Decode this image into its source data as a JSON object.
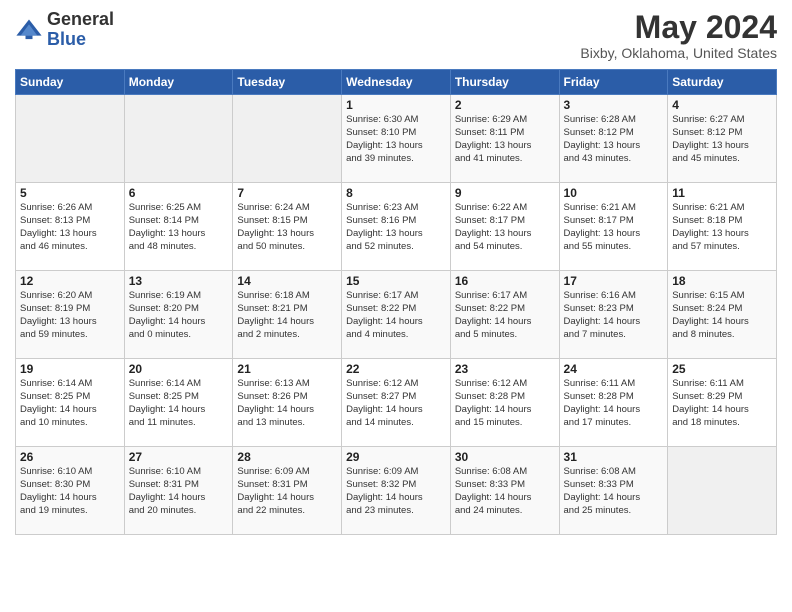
{
  "logo": {
    "general": "General",
    "blue": "Blue"
  },
  "title": "May 2024",
  "subtitle": "Bixby, Oklahoma, United States",
  "days_of_week": [
    "Sunday",
    "Monday",
    "Tuesday",
    "Wednesday",
    "Thursday",
    "Friday",
    "Saturday"
  ],
  "weeks": [
    [
      {
        "day": "",
        "info": ""
      },
      {
        "day": "",
        "info": ""
      },
      {
        "day": "",
        "info": ""
      },
      {
        "day": "1",
        "info": "Sunrise: 6:30 AM\nSunset: 8:10 PM\nDaylight: 13 hours\nand 39 minutes."
      },
      {
        "day": "2",
        "info": "Sunrise: 6:29 AM\nSunset: 8:11 PM\nDaylight: 13 hours\nand 41 minutes."
      },
      {
        "day": "3",
        "info": "Sunrise: 6:28 AM\nSunset: 8:12 PM\nDaylight: 13 hours\nand 43 minutes."
      },
      {
        "day": "4",
        "info": "Sunrise: 6:27 AM\nSunset: 8:12 PM\nDaylight: 13 hours\nand 45 minutes."
      }
    ],
    [
      {
        "day": "5",
        "info": "Sunrise: 6:26 AM\nSunset: 8:13 PM\nDaylight: 13 hours\nand 46 minutes."
      },
      {
        "day": "6",
        "info": "Sunrise: 6:25 AM\nSunset: 8:14 PM\nDaylight: 13 hours\nand 48 minutes."
      },
      {
        "day": "7",
        "info": "Sunrise: 6:24 AM\nSunset: 8:15 PM\nDaylight: 13 hours\nand 50 minutes."
      },
      {
        "day": "8",
        "info": "Sunrise: 6:23 AM\nSunset: 8:16 PM\nDaylight: 13 hours\nand 52 minutes."
      },
      {
        "day": "9",
        "info": "Sunrise: 6:22 AM\nSunset: 8:17 PM\nDaylight: 13 hours\nand 54 minutes."
      },
      {
        "day": "10",
        "info": "Sunrise: 6:21 AM\nSunset: 8:17 PM\nDaylight: 13 hours\nand 55 minutes."
      },
      {
        "day": "11",
        "info": "Sunrise: 6:21 AM\nSunset: 8:18 PM\nDaylight: 13 hours\nand 57 minutes."
      }
    ],
    [
      {
        "day": "12",
        "info": "Sunrise: 6:20 AM\nSunset: 8:19 PM\nDaylight: 13 hours\nand 59 minutes."
      },
      {
        "day": "13",
        "info": "Sunrise: 6:19 AM\nSunset: 8:20 PM\nDaylight: 14 hours\nand 0 minutes."
      },
      {
        "day": "14",
        "info": "Sunrise: 6:18 AM\nSunset: 8:21 PM\nDaylight: 14 hours\nand 2 minutes."
      },
      {
        "day": "15",
        "info": "Sunrise: 6:17 AM\nSunset: 8:22 PM\nDaylight: 14 hours\nand 4 minutes."
      },
      {
        "day": "16",
        "info": "Sunrise: 6:17 AM\nSunset: 8:22 PM\nDaylight: 14 hours\nand 5 minutes."
      },
      {
        "day": "17",
        "info": "Sunrise: 6:16 AM\nSunset: 8:23 PM\nDaylight: 14 hours\nand 7 minutes."
      },
      {
        "day": "18",
        "info": "Sunrise: 6:15 AM\nSunset: 8:24 PM\nDaylight: 14 hours\nand 8 minutes."
      }
    ],
    [
      {
        "day": "19",
        "info": "Sunrise: 6:14 AM\nSunset: 8:25 PM\nDaylight: 14 hours\nand 10 minutes."
      },
      {
        "day": "20",
        "info": "Sunrise: 6:14 AM\nSunset: 8:25 PM\nDaylight: 14 hours\nand 11 minutes."
      },
      {
        "day": "21",
        "info": "Sunrise: 6:13 AM\nSunset: 8:26 PM\nDaylight: 14 hours\nand 13 minutes."
      },
      {
        "day": "22",
        "info": "Sunrise: 6:12 AM\nSunset: 8:27 PM\nDaylight: 14 hours\nand 14 minutes."
      },
      {
        "day": "23",
        "info": "Sunrise: 6:12 AM\nSunset: 8:28 PM\nDaylight: 14 hours\nand 15 minutes."
      },
      {
        "day": "24",
        "info": "Sunrise: 6:11 AM\nSunset: 8:28 PM\nDaylight: 14 hours\nand 17 minutes."
      },
      {
        "day": "25",
        "info": "Sunrise: 6:11 AM\nSunset: 8:29 PM\nDaylight: 14 hours\nand 18 minutes."
      }
    ],
    [
      {
        "day": "26",
        "info": "Sunrise: 6:10 AM\nSunset: 8:30 PM\nDaylight: 14 hours\nand 19 minutes."
      },
      {
        "day": "27",
        "info": "Sunrise: 6:10 AM\nSunset: 8:31 PM\nDaylight: 14 hours\nand 20 minutes."
      },
      {
        "day": "28",
        "info": "Sunrise: 6:09 AM\nSunset: 8:31 PM\nDaylight: 14 hours\nand 22 minutes."
      },
      {
        "day": "29",
        "info": "Sunrise: 6:09 AM\nSunset: 8:32 PM\nDaylight: 14 hours\nand 23 minutes."
      },
      {
        "day": "30",
        "info": "Sunrise: 6:08 AM\nSunset: 8:33 PM\nDaylight: 14 hours\nand 24 minutes."
      },
      {
        "day": "31",
        "info": "Sunrise: 6:08 AM\nSunset: 8:33 PM\nDaylight: 14 hours\nand 25 minutes."
      },
      {
        "day": "",
        "info": ""
      }
    ]
  ]
}
